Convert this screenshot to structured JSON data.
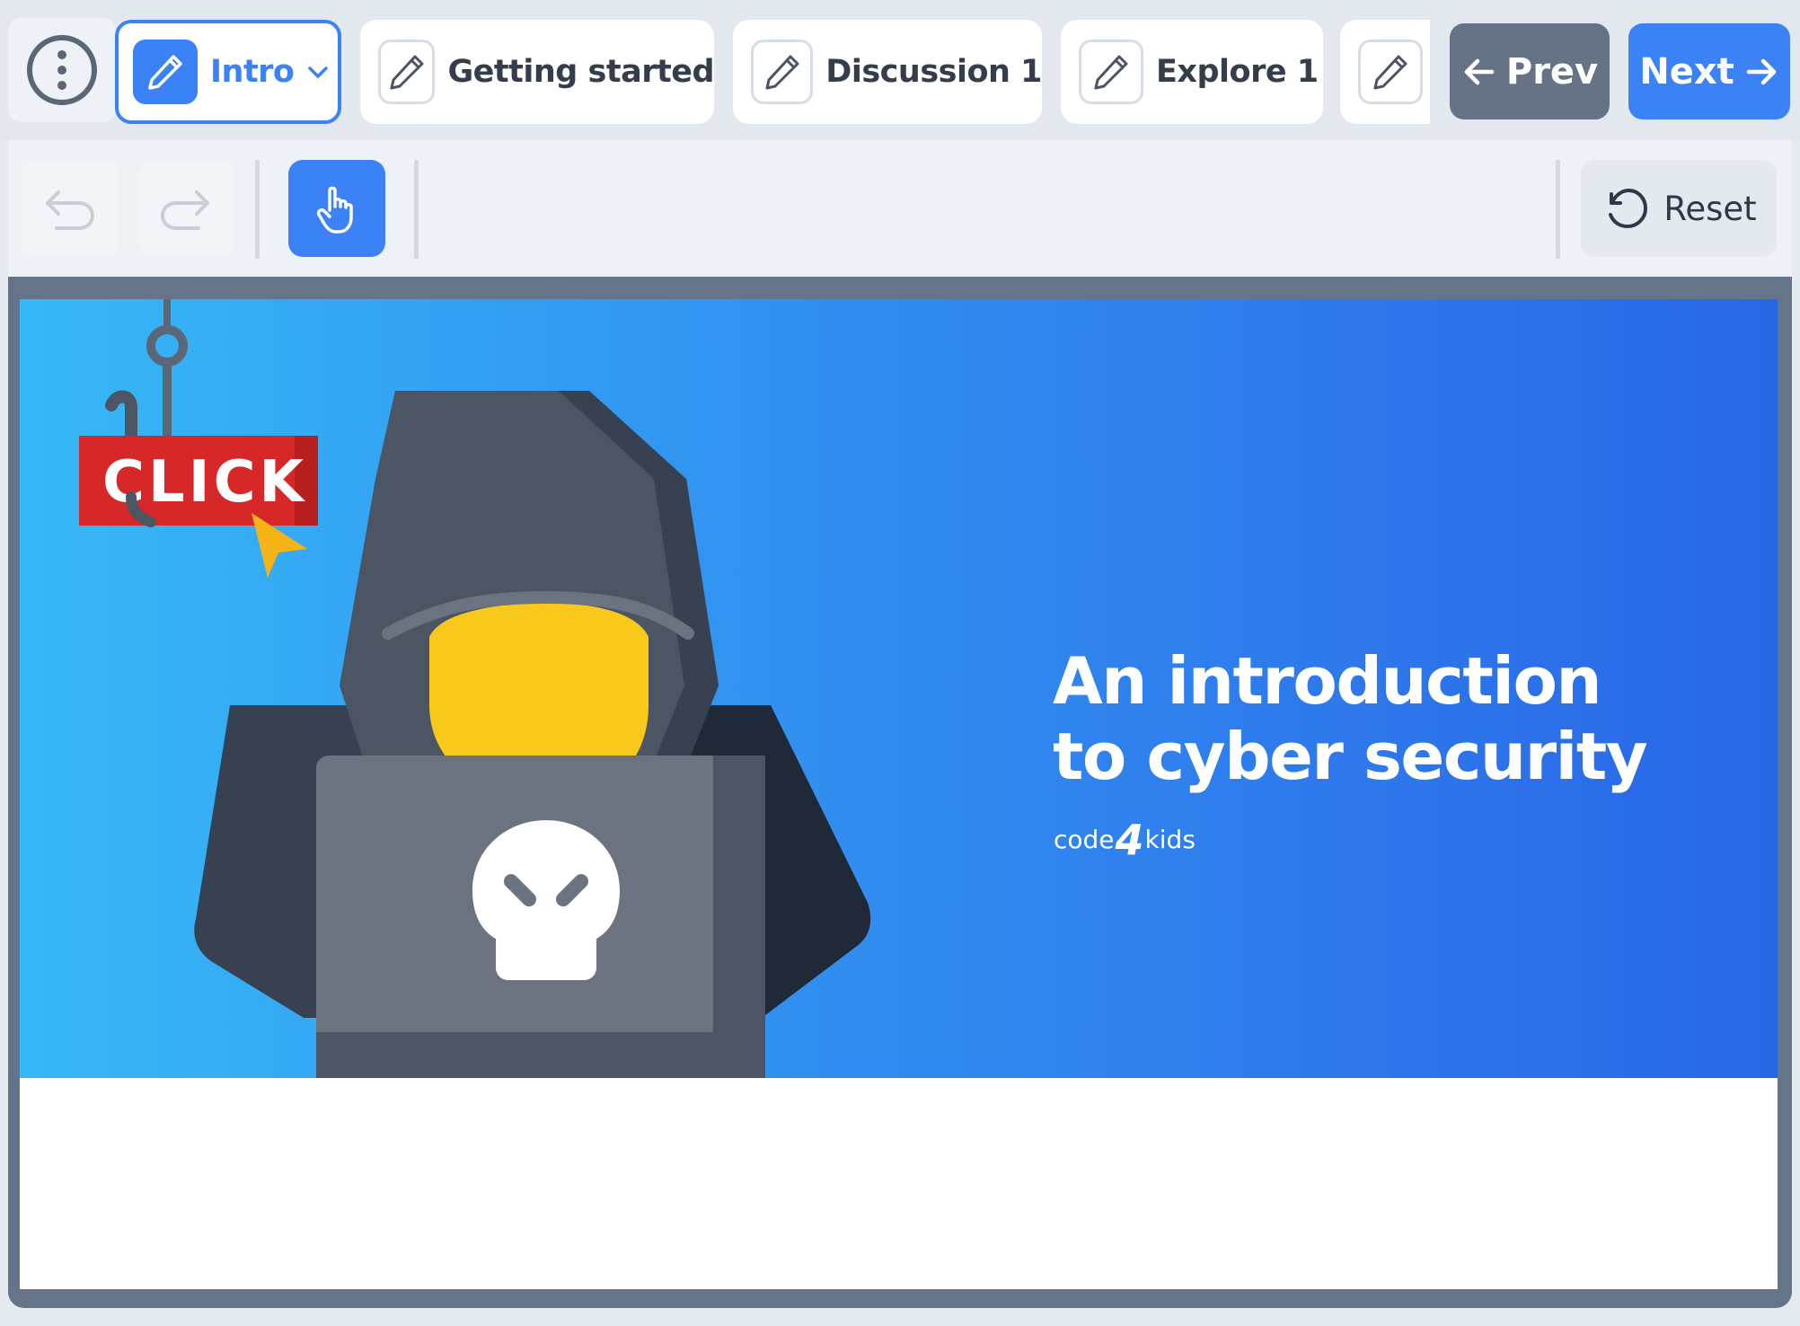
{
  "tabs": [
    {
      "label": "Intro",
      "active": true
    },
    {
      "label": "Getting started"
    },
    {
      "label": "Discussion 1"
    },
    {
      "label": "Explore 1"
    },
    {
      "label": ""
    }
  ],
  "nav": {
    "prev_label": "Prev",
    "next_label": "Next"
  },
  "toolbar": {
    "reset_label": "Reset"
  },
  "slide": {
    "title": "An introduction to cyber security",
    "brand_pre": "code",
    "brand_num": "4",
    "brand_post": "kids",
    "sign_text": "CLICK"
  },
  "colors": {
    "accent": "#3b82f6",
    "prev": "#667285",
    "banner_start": "#37b8f6",
    "banner_end": "#2866e6"
  },
  "icons": [
    "more-vertical-icon",
    "pencil-icon",
    "chevron-down-icon",
    "arrow-left-icon",
    "arrow-right-icon",
    "undo-icon",
    "redo-icon",
    "hand-pointer-icon",
    "reset-icon"
  ]
}
